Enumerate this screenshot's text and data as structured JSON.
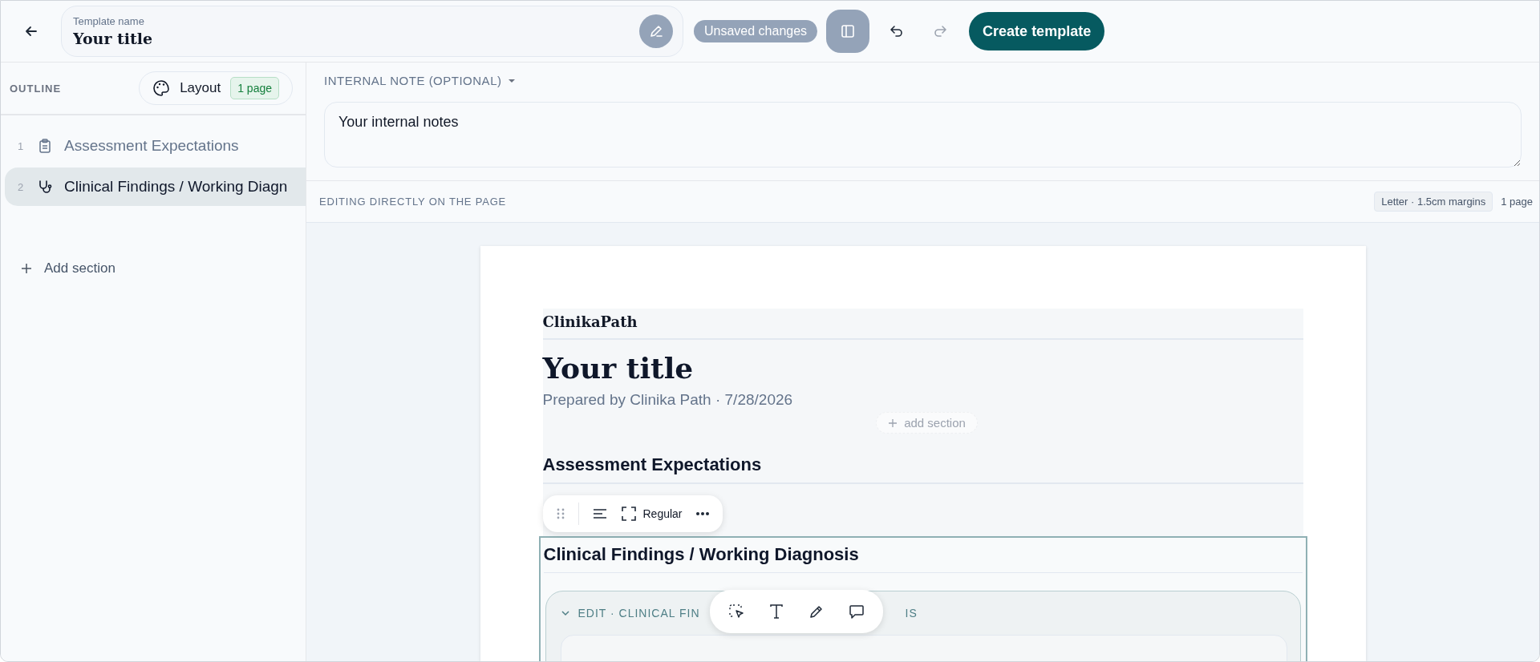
{
  "top_bar": {
    "template_name": {
      "label": "Template name",
      "value": "Your title"
    },
    "status_badge": "Unsaved changes",
    "primary_button": "Create template"
  },
  "sidebar": {
    "heading": "OUTLINE",
    "layout_button": {
      "label": "Layout",
      "badge": "1 page"
    },
    "items": [
      {
        "number": "1",
        "label": "Assessment Expectations",
        "kind": "clipboard",
        "selected": false
      },
      {
        "number": "2",
        "label": "Clinical Findings / Working Diagn",
        "kind": "stethoscope",
        "selected": true
      }
    ],
    "add_section": "Add section"
  },
  "internal_note": {
    "label": "INTERNAL NOTE (OPTIONAL)",
    "value": "Your internal notes"
  },
  "editing_bar": {
    "label": "EDITING DIRECTLY ON THE PAGE",
    "page_setup": "Letter · 1.5cm margins",
    "page_count": "1 page"
  },
  "document": {
    "brand": "ClinikaPath",
    "title": "Your title",
    "byline": "Prepared by Clinika Path · 7/28/2026",
    "add_section": "add section",
    "block_toolbar": {
      "size_label": "Regular"
    },
    "sections": [
      {
        "heading": "Assessment Expectations",
        "selected": false
      },
      {
        "heading": "Clinical Findings / Working Diagnosis",
        "selected": true
      }
    ],
    "edit_panel": {
      "title_start": "EDIT · CLINICAL FIN",
      "title_end": "IS"
    }
  }
}
